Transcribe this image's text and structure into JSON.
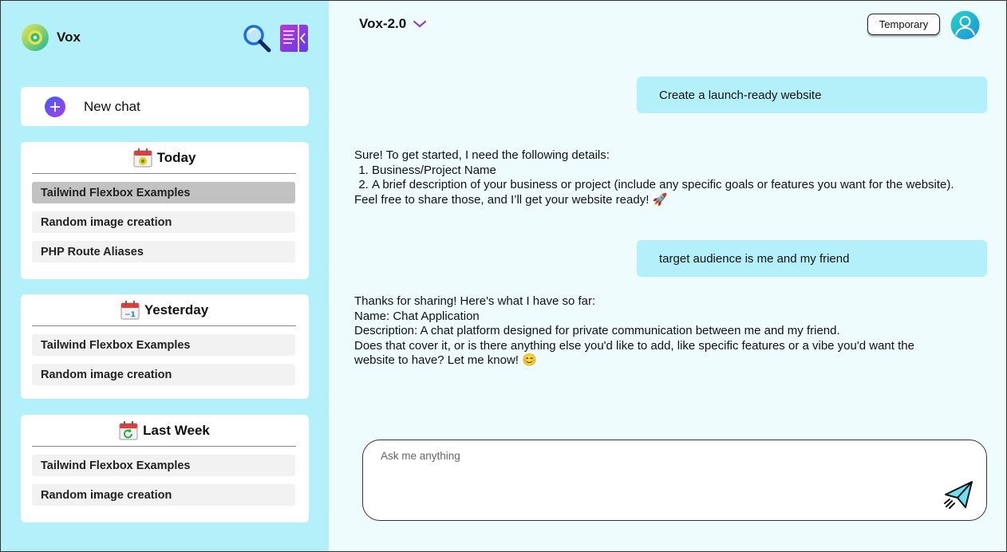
{
  "app": {
    "name": "Vox"
  },
  "sidebar": {
    "new_chat_label": "New chat",
    "groups": [
      {
        "title": "Today",
        "items": [
          "Tailwind Flexbox Examples",
          "Random image creation",
          "PHP Route Aliases"
        ]
      },
      {
        "title": "Yesterday",
        "items": [
          "Tailwind Flexbox Examples",
          "Random image creation"
        ]
      },
      {
        "title": "Last Week",
        "items": [
          "Tailwind Flexbox Examples",
          "Random image creation"
        ]
      }
    ]
  },
  "header": {
    "model_name": "Vox-2.0",
    "temporary_label": "Temporary"
  },
  "conversation": {
    "user_1": "Create a launch-ready website",
    "bot_1": {
      "intro": "Sure! To get started, I need the following details:",
      "list": [
        "Business/Project Name",
        "A brief description of your business or project (include any specific goals or features you want for the website)."
      ],
      "outro": "Feel free to share those, and I’ll get your website ready! 🚀"
    },
    "user_2": "target audience is me and my friend",
    "bot_2": {
      "line_1": "Thanks for sharing! Here's what I have so far:",
      "line_2": "Name: Chat Application",
      "line_3": "Description: A chat platform designed for private communication between me and my friend.",
      "line_4": "Does that cover it, or is there anything else you'd like to add, like specific features or a vibe you'd want the website to have? Let me know! 😊"
    }
  },
  "composer": {
    "placeholder": "Ask me anything"
  },
  "colors": {
    "sidebar_bg": "#b4f0f9",
    "main_bg": "#eefcfe",
    "user_bubble": "#b4f0f9",
    "accent_purple": "#8b2fc9"
  }
}
